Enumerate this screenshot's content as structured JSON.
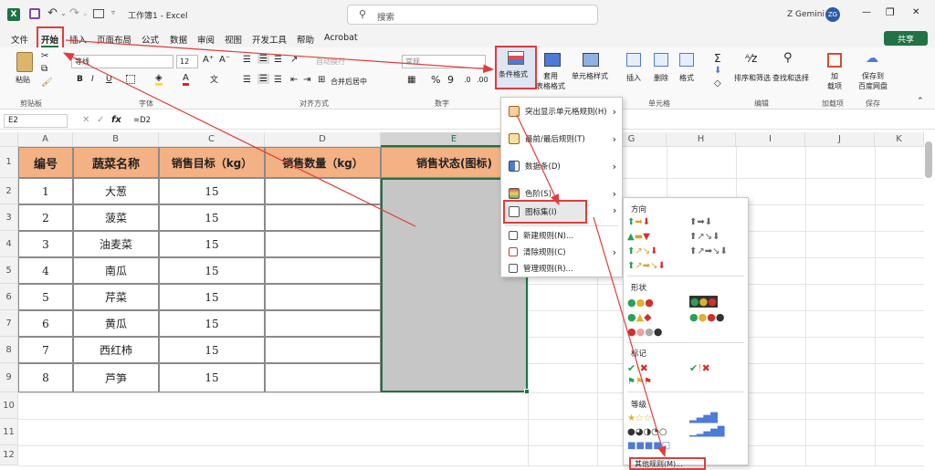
{
  "titlebar": {
    "autosave": "",
    "filename": "工作簿1 - Excel",
    "search_placeholder": "搜索",
    "user": "Z Gemini",
    "avatar": "ZG",
    "win_min": "—",
    "win_max": "❐",
    "win_close": "✕"
  },
  "menu": {
    "tabs": [
      "文件",
      "开始",
      "插入",
      "页面布局",
      "公式",
      "数据",
      "审阅",
      "视图",
      "开发工具",
      "帮助",
      "Acrobat"
    ],
    "share": "共享"
  },
  "ribbon": {
    "paste": "粘贴",
    "clipboard": "剪贴板",
    "font_name": "等线",
    "font_size": "12",
    "bold": "B",
    "italic": "I",
    "underline": "U",
    "font_group": "字体",
    "wrap": "自动换行",
    "merge": "合并后居中",
    "align_group": "对齐方式",
    "number_format": "常规",
    "percent": "%",
    "number_group": "数字",
    "cond_format": "条件格式",
    "table_format": "套用\n表格格式",
    "cell_style": "单元格样式",
    "insert": "插入",
    "delete": "删除",
    "format": "格式",
    "cells_group": "单元格",
    "sort": "排序和筛选",
    "find": "查找和选择",
    "edit_group": "编辑",
    "addin": "加\n载项",
    "addin_group": "加载项",
    "save_baidu": "保存到\n百度网盘",
    "save_group": "保存"
  },
  "formula": {
    "namebox": "E2",
    "fx": "fx",
    "value": "=D2"
  },
  "columns": [
    "A",
    "B",
    "C",
    "D",
    "E",
    "F",
    "G",
    "H",
    "I",
    "J",
    "K"
  ],
  "rows": [
    "1",
    "2",
    "3",
    "4",
    "5",
    "6",
    "7",
    "8",
    "9",
    "10",
    "11",
    "12"
  ],
  "table": {
    "headers": [
      "编号",
      "蔬菜名称",
      "销售目标（kg）",
      "销售数量（kg）",
      "销售状态(图标)"
    ],
    "data": [
      [
        "1",
        "大葱",
        "15"
      ],
      [
        "2",
        "菠菜",
        "15"
      ],
      [
        "3",
        "油麦菜",
        "15"
      ],
      [
        "4",
        "南瓜",
        "15"
      ],
      [
        "5",
        "芹菜",
        "15"
      ],
      [
        "6",
        "黄瓜",
        "15"
      ],
      [
        "7",
        "西红柿",
        "15"
      ],
      [
        "8",
        "芦笋",
        "15"
      ]
    ]
  },
  "cf_menu": [
    {
      "label": "突出显示单元格规则(H)",
      "sub": "›"
    },
    {
      "label": "最前/最后规则(T)",
      "sub": "›"
    },
    {
      "label": "数据条(D)",
      "sub": "›"
    },
    {
      "label": "色阶(S)",
      "sub": "›"
    },
    {
      "label": "图标集(I)",
      "sub": "›"
    },
    {
      "label": "新建规则(N)...",
      "sub": ""
    },
    {
      "label": "清除规则(C)",
      "sub": "›"
    },
    {
      "label": "管理规则(R)...",
      "sub": ""
    }
  ],
  "iconsets": {
    "directions": "方向",
    "shapes": "形状",
    "markers": "标记",
    "ratings": "等级",
    "more": "其他规则(M)..."
  },
  "colors": {
    "header_fill": "#f4b183",
    "selected_fill": "#c6c6c6",
    "excel_green": "#217346",
    "arrow_red": "#e03c3c",
    "highlight_box": "#e03c3c"
  }
}
